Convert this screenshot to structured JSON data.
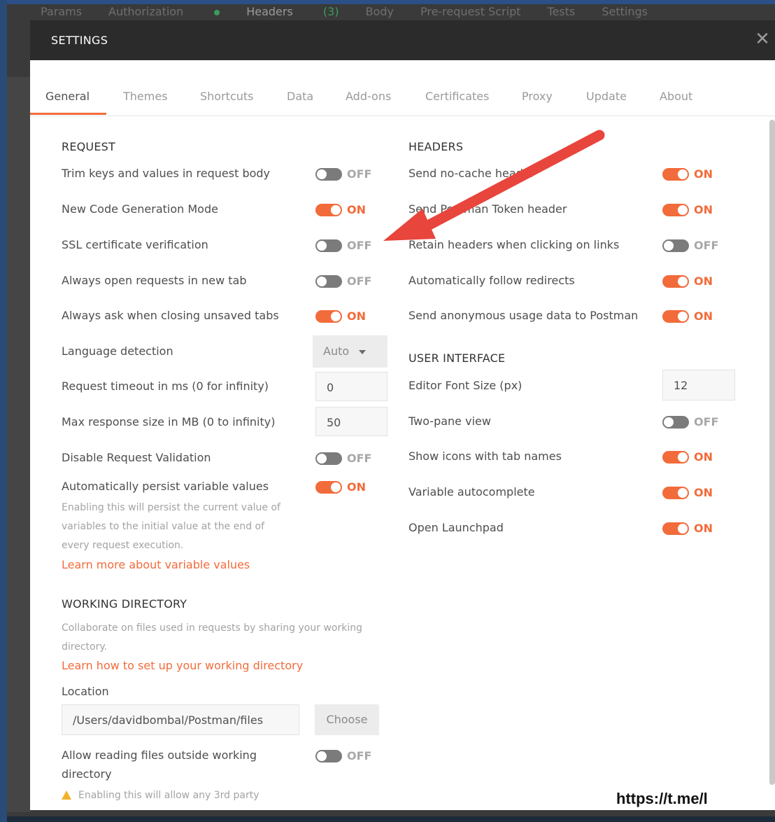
{
  "background_tabs": {
    "params": "Params",
    "authorization": "Authorization",
    "headers": "Headers",
    "headers_count": "(3)",
    "body": "Body",
    "prerequest": "Pre-request Script",
    "tests": "Tests",
    "settings": "Settings"
  },
  "modal": {
    "title": "SETTINGS",
    "close_icon": "close-icon"
  },
  "tabs": [
    "General",
    "Themes",
    "Shortcuts",
    "Data",
    "Add-ons",
    "Certificates",
    "Proxy",
    "Update",
    "About"
  ],
  "active_tab": "General",
  "request": {
    "title": "REQUEST",
    "trim_keys": {
      "label": "Trim keys and values in request body",
      "state": "OFF"
    },
    "code_gen": {
      "label": "New Code Generation Mode",
      "state": "ON"
    },
    "ssl": {
      "label": "SSL certificate verification",
      "state": "OFF"
    },
    "new_tab": {
      "label": "Always open requests in new tab",
      "state": "OFF"
    },
    "ask_closing": {
      "label": "Always ask when closing unsaved tabs",
      "state": "ON"
    },
    "language": {
      "label": "Language detection",
      "value": "Auto"
    },
    "timeout": {
      "label": "Request timeout in ms (0 for infinity)",
      "value": "0"
    },
    "max_response": {
      "label": "Max response size in MB (0 to infinity)",
      "value": "50"
    },
    "disable_validation": {
      "label": "Disable Request Validation",
      "state": "OFF"
    },
    "persist_vars": {
      "label": "Automatically persist variable values",
      "state": "ON"
    },
    "persist_desc_1": "Enabling this will persist the current value of",
    "persist_desc_2": "variables to the initial value at the end of",
    "persist_desc_3": "every request execution.",
    "persist_link": "Learn more about variable values"
  },
  "working_dir": {
    "title": "WORKING DIRECTORY",
    "desc_1": "Collaborate on files used in requests by sharing your working",
    "desc_2": "directory.",
    "link": "Learn how to set up your working directory",
    "location_label": "Location",
    "location_value": "/Users/davidbombal/Postman/files",
    "choose_button": "Choose",
    "allow_reading_1": "Allow reading files outside working",
    "allow_reading_2": "directory",
    "allow_reading_state": "OFF",
    "warning": "Enabling this will allow any 3rd party"
  },
  "headers": {
    "title": "HEADERS",
    "no_cache": {
      "label": "Send no-cache header",
      "state": "ON"
    },
    "token": {
      "label": "Send Postman Token header",
      "state": "ON"
    },
    "retain": {
      "label": "Retain headers when clicking on links",
      "state": "OFF"
    },
    "redirects": {
      "label": "Automatically follow redirects",
      "state": "ON"
    },
    "anon": {
      "label": "Send anonymous usage data to Postman",
      "state": "ON"
    }
  },
  "ui": {
    "title": "USER INTERFACE",
    "font_size": {
      "label": "Editor Font Size (px)",
      "value": "12"
    },
    "two_pane": {
      "label": "Two-pane view",
      "state": "OFF"
    },
    "icons": {
      "label": "Show icons with tab names",
      "state": "ON"
    },
    "autocomplete": {
      "label": "Variable autocomplete",
      "state": "ON"
    },
    "launchpad": {
      "label": "Open Launchpad",
      "state": "ON"
    }
  },
  "watermark": "https://t.me/l",
  "colors": {
    "accent": "#f26b3a",
    "header_bg": "#2b2b2b",
    "arrow": "#e8453c"
  }
}
